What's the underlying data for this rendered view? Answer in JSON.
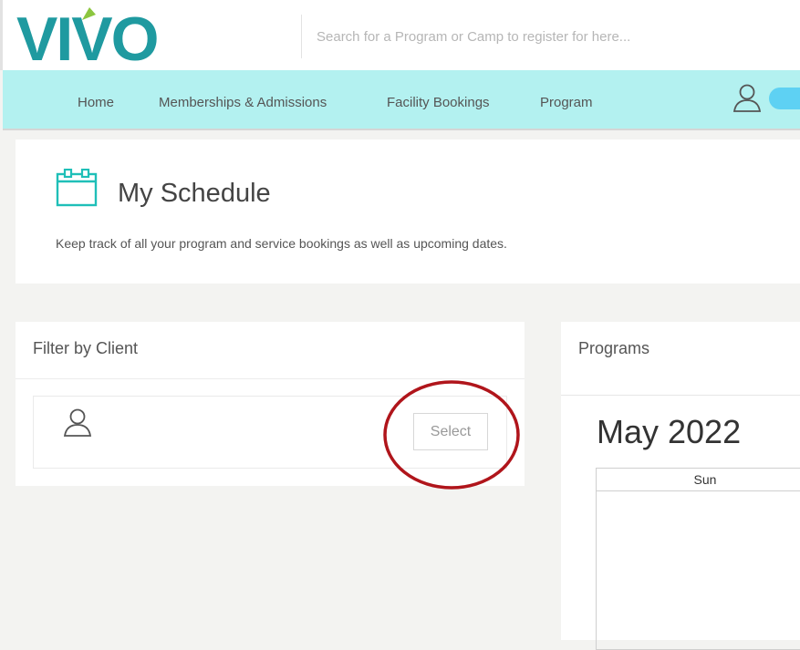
{
  "brand": {
    "logo_text": "VIVO",
    "primary_color": "#1f9aa0",
    "leaf_color": "#8cc63f"
  },
  "search": {
    "placeholder": "Search for a Program or Camp to register for here..."
  },
  "nav": {
    "items": [
      {
        "label": "Home"
      },
      {
        "label": "Memberships & Admissions"
      },
      {
        "label": "Facility Bookings"
      },
      {
        "label": "Program"
      }
    ],
    "user_icon": "user-icon",
    "bar_color": "#b3f1f0"
  },
  "header": {
    "icon": "calendar-icon",
    "title": "My Schedule",
    "subtitle": "Keep track of all your program and service bookings as well as upcoming dates."
  },
  "filter": {
    "title": "Filter by Client",
    "client_icon": "user-icon",
    "select_label": "Select",
    "annotation": "red-circle-highlight",
    "annotation_color": "#b0151b"
  },
  "programs": {
    "title": "Programs",
    "month": "May 2022",
    "day_headers": [
      "Sun"
    ]
  }
}
